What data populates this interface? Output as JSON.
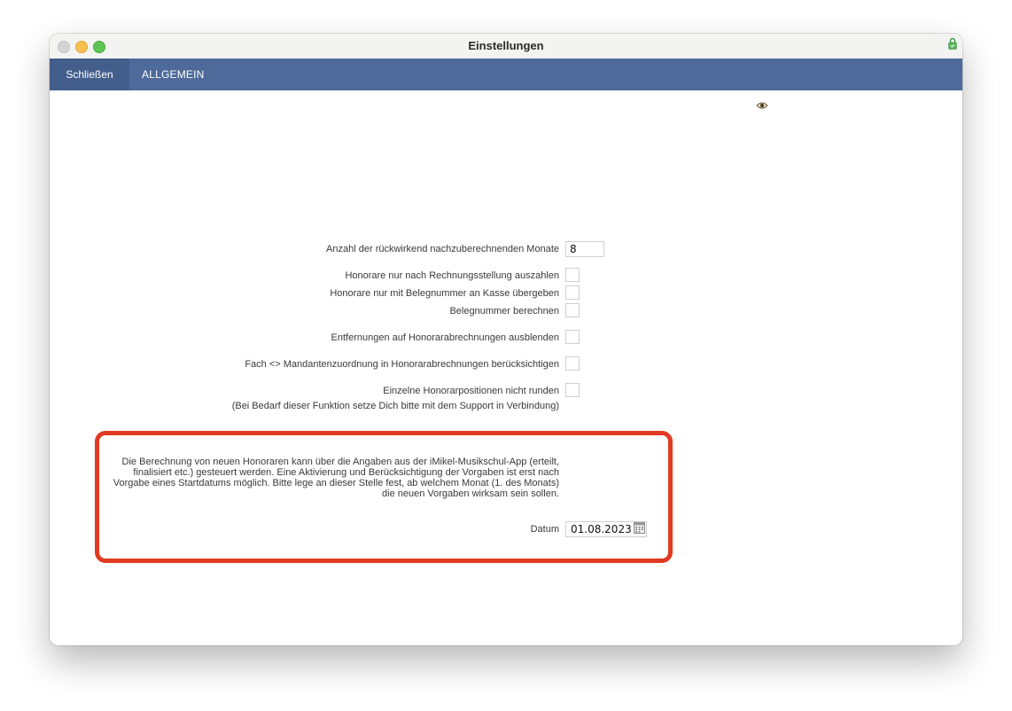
{
  "window": {
    "title": "Einstellungen"
  },
  "toolbar": {
    "close_label": "Schließen",
    "general_label": "ALLGEMEIN"
  },
  "settings": {
    "months_label": "Anzahl der rückwirkend nachzuberechnenden Monate",
    "months_value": "8",
    "checkboxes": [
      {
        "label": "Honorare nur nach Rechnungsstellung auszahlen",
        "checked": false
      },
      {
        "label": "Honorare nur mit Belegnummer an Kasse übergeben",
        "checked": false
      },
      {
        "label": "Belegnummer berechnen",
        "checked": false
      },
      {
        "label": "Entfernungen auf Honorarabrechnungen ausblenden",
        "checked": false
      },
      {
        "label": "Fach <> Mandantenzuordnung in Honorarabrechnungen berücksichtigen",
        "checked": false
      },
      {
        "label": "Einzelne Honorarpositionen nicht runden",
        "checked": false
      }
    ],
    "rounding_hint": "(Bei Bedarf dieser Funktion setze Dich bitte mit dem Support in Verbindung)"
  },
  "app_section": {
    "description": "Die Berechnung von neuen Honoraren kann über die Angaben aus der iMikel-Musikschul-App (erteilt, finalisiert etc.) gesteuert werden. Eine Aktivierung und Berücksichtigung der Vorgaben ist erst nach Vorgabe eines Startdatums möglich. Bitte lege an dieser Stelle fest, ab welchem Monat (1. des Monats) die neuen Vorgaben wirksam sein sollen.",
    "date_label": "Datum",
    "date_value": "01.08.2023"
  },
  "colors": {
    "toolbar": "#4d6a9a",
    "highlight_border": "#e03a22"
  },
  "icons": [
    "lock-icon",
    "eye-icon",
    "calendar-icon"
  ]
}
